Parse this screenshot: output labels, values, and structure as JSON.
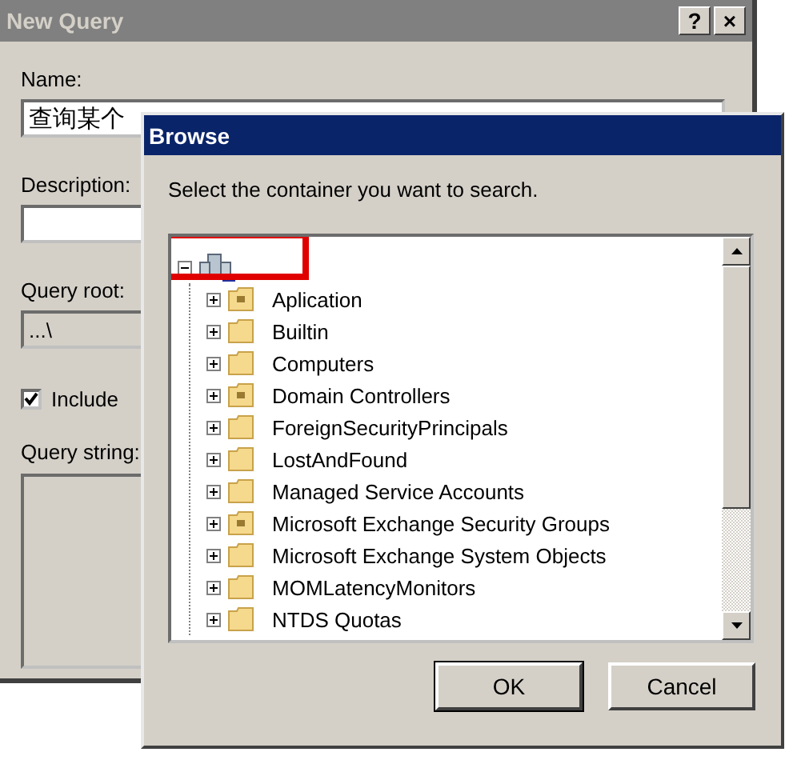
{
  "back_dialog": {
    "title": "New Query",
    "title_buttons": [
      "?",
      "×"
    ],
    "name": {
      "label": "Name:",
      "value": "查询某个"
    },
    "description": {
      "label": "Description:"
    },
    "query_root": {
      "label": "Query root:",
      "value": "...\\"
    },
    "include": {
      "label": "Include",
      "checked": true
    },
    "query_string": {
      "label": "Query string:"
    }
  },
  "browse": {
    "title": "Browse",
    "prompt": "Select the container you want to search.",
    "tree": {
      "expanded": true,
      "highlighted": true,
      "children": [
        {
          "label": "Aplication",
          "kind": "ou",
          "expanded": false
        },
        {
          "label": "Builtin",
          "kind": "container",
          "expanded": false
        },
        {
          "label": "Computers",
          "kind": "container",
          "expanded": false
        },
        {
          "label": "Domain Controllers",
          "kind": "ou",
          "expanded": false
        },
        {
          "label": "ForeignSecurityPrincipals",
          "kind": "container",
          "expanded": false
        },
        {
          "label": "LostAndFound",
          "kind": "container",
          "expanded": false
        },
        {
          "label": "Managed Service Accounts",
          "kind": "container",
          "expanded": false
        },
        {
          "label": "Microsoft Exchange Security Groups",
          "kind": "ou",
          "expanded": false
        },
        {
          "label": "Microsoft Exchange System Objects",
          "kind": "container",
          "expanded": false
        },
        {
          "label": "MOMLatencyMonitors",
          "kind": "container",
          "expanded": false
        },
        {
          "label": "NTDS Quotas",
          "kind": "container",
          "expanded": false
        }
      ]
    },
    "buttons": [
      "OK",
      "Cancel"
    ]
  }
}
